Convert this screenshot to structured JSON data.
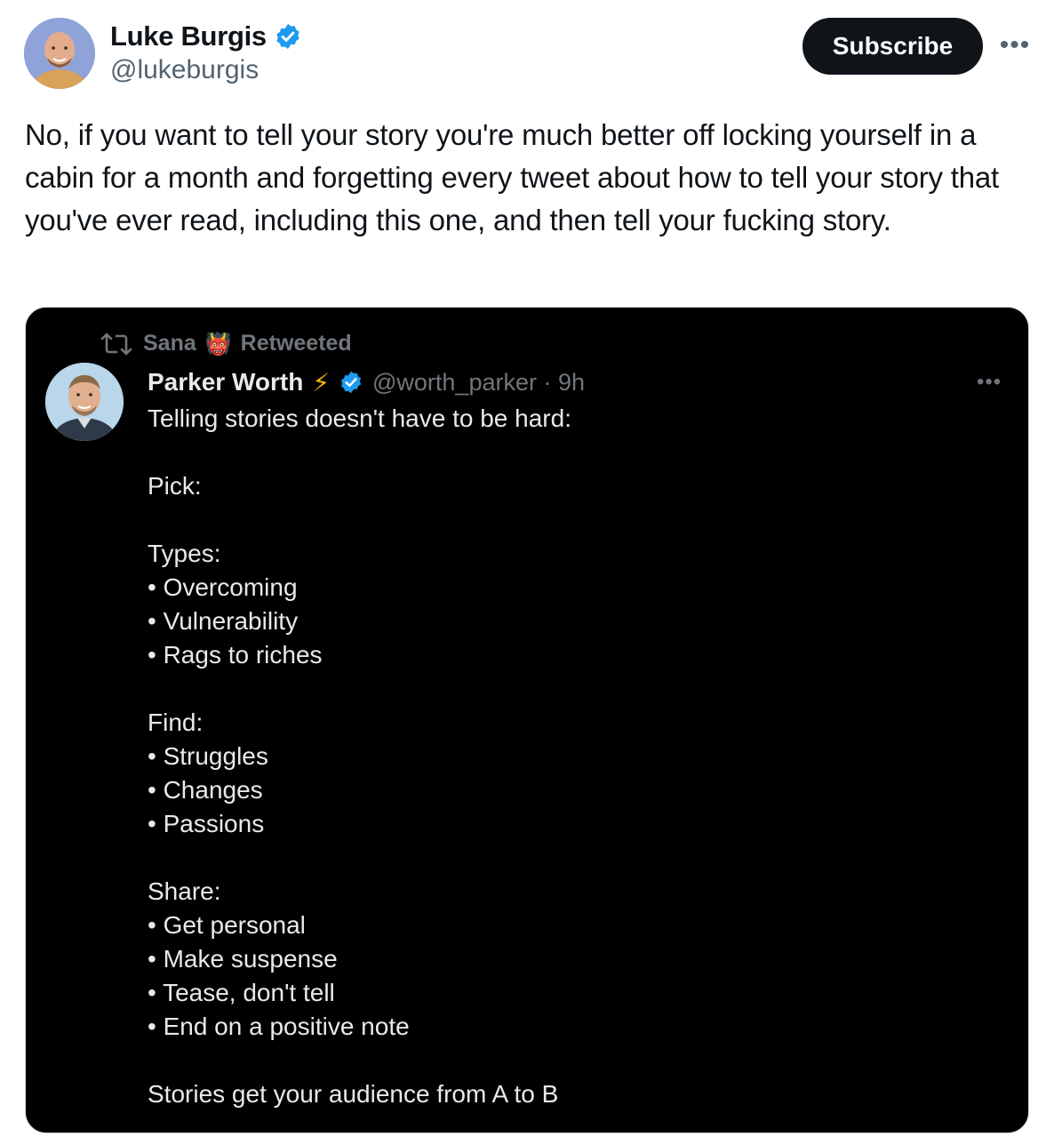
{
  "author": {
    "name": "Luke Burgis",
    "handle": "@lukeburgis",
    "verified_color": "#1d9bf0"
  },
  "actions": {
    "subscribe_label": "Subscribe",
    "more_label": "•••"
  },
  "tweet": {
    "text": "No, if you want to tell your story you're much better off locking yourself in a cabin for a month and forgetting every tweet about how to tell your story that you've ever read, including this one, and then tell your fucking story."
  },
  "embedded": {
    "retweeted_by": "Sana",
    "retweeted_emoji": "👹",
    "retweeted_label": "Retweeted",
    "author_name": "Parker Worth",
    "author_emoji": "⚡",
    "author_handle_time": "@worth_parker · 9h",
    "more_label": "•••",
    "lines": [
      "Telling stories doesn't have to be hard:",
      "",
      "Pick:",
      "",
      "Types:",
      "• Overcoming",
      "• Vulnerability",
      "• Rags to riches",
      "",
      "Find:",
      "• Struggles",
      "• Changes",
      "• Passions",
      "",
      "Share:",
      "• Get personal",
      "• Make suspense",
      "• Tease, don't tell",
      "• End on a positive note",
      "",
      "Stories get your audience from A to B"
    ]
  }
}
